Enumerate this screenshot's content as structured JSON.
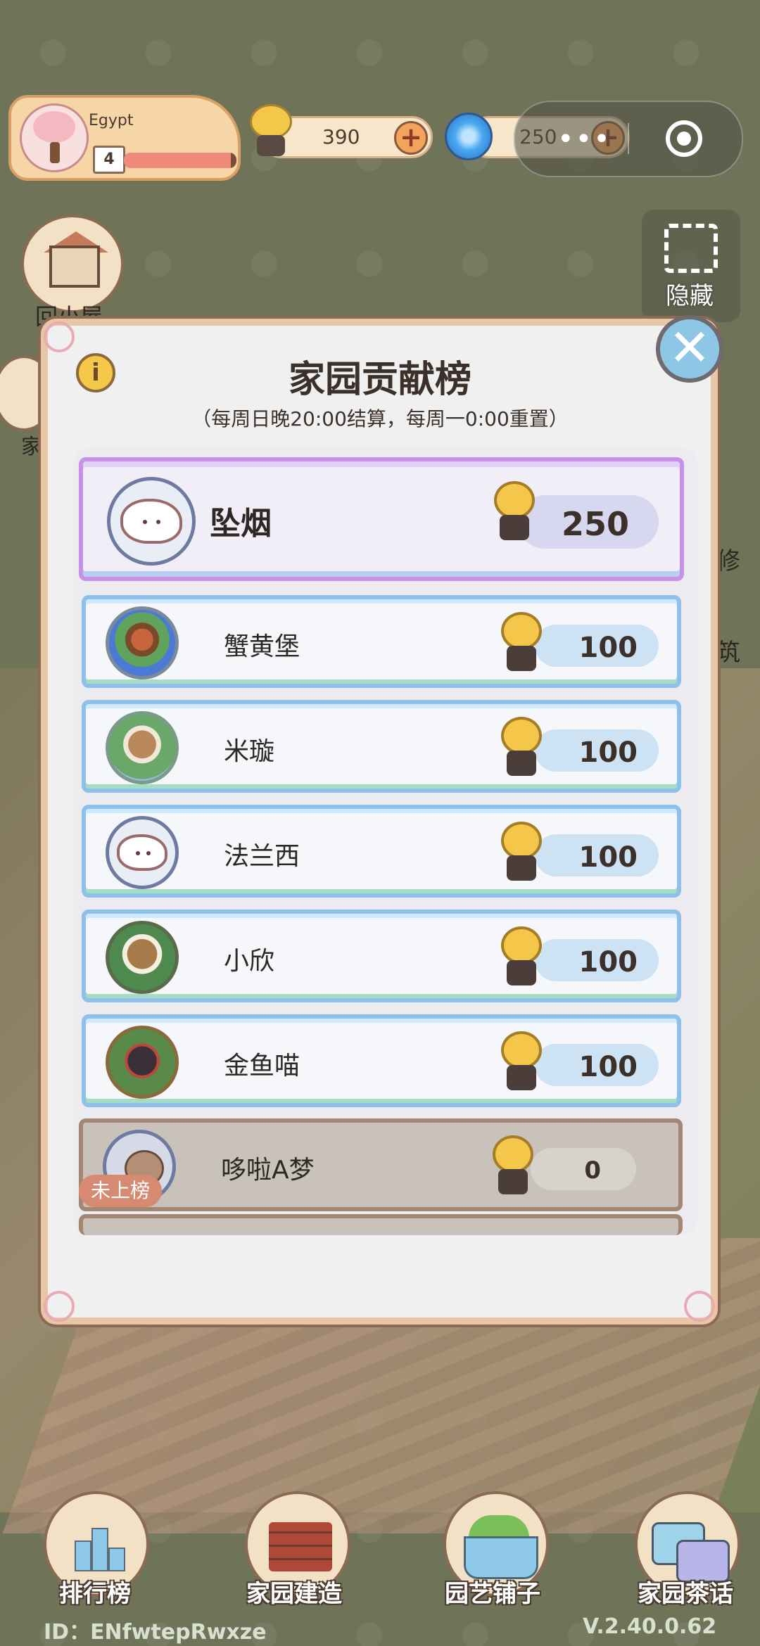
{
  "player": {
    "name": "Egypt",
    "level": "4",
    "xp_fraction": 0.95
  },
  "currencies": {
    "snail_coins": "390",
    "water": "250"
  },
  "capsule": {
    "more": "•••"
  },
  "left_buttons": {
    "home_label": "回小屋",
    "side_label": "家"
  },
  "right_buttons": {
    "hide_label": "隐藏",
    "edit_fragment": "修",
    "build_fragment": "筑"
  },
  "modal": {
    "title": "家园贡献榜",
    "subtitle": "（每周日晚20:00结算，每周一0:00重置）",
    "info_label": "i",
    "close_label": "✕"
  },
  "leaderboard": [
    {
      "name": "坠烟",
      "score": "250",
      "avatar": "cloud"
    },
    {
      "name": "蟹黄堡",
      "score": "100",
      "avatar": "pic1"
    },
    {
      "name": "米璇",
      "score": "100",
      "avatar": "pic2"
    },
    {
      "name": "法兰西",
      "score": "100",
      "avatar": "cloud"
    },
    {
      "name": "小欣",
      "score": "100",
      "avatar": "pic3"
    },
    {
      "name": "金鱼喵",
      "score": "100",
      "avatar": "pic4"
    }
  ],
  "self_entry": {
    "name": "哆啦A梦",
    "score": "0",
    "tag": "未上榜"
  },
  "bottom_nav": [
    {
      "label": "排行榜",
      "icon": "ranking-icon"
    },
    {
      "label": "家园建造",
      "icon": "bricks-icon"
    },
    {
      "label": "园艺铺子",
      "icon": "flower-basket-icon"
    },
    {
      "label": "家园茶话",
      "icon": "chat-icon"
    }
  ],
  "footer": {
    "id": "ID：ENfwtepRwxze",
    "version": "V.2.40.0.62"
  }
}
